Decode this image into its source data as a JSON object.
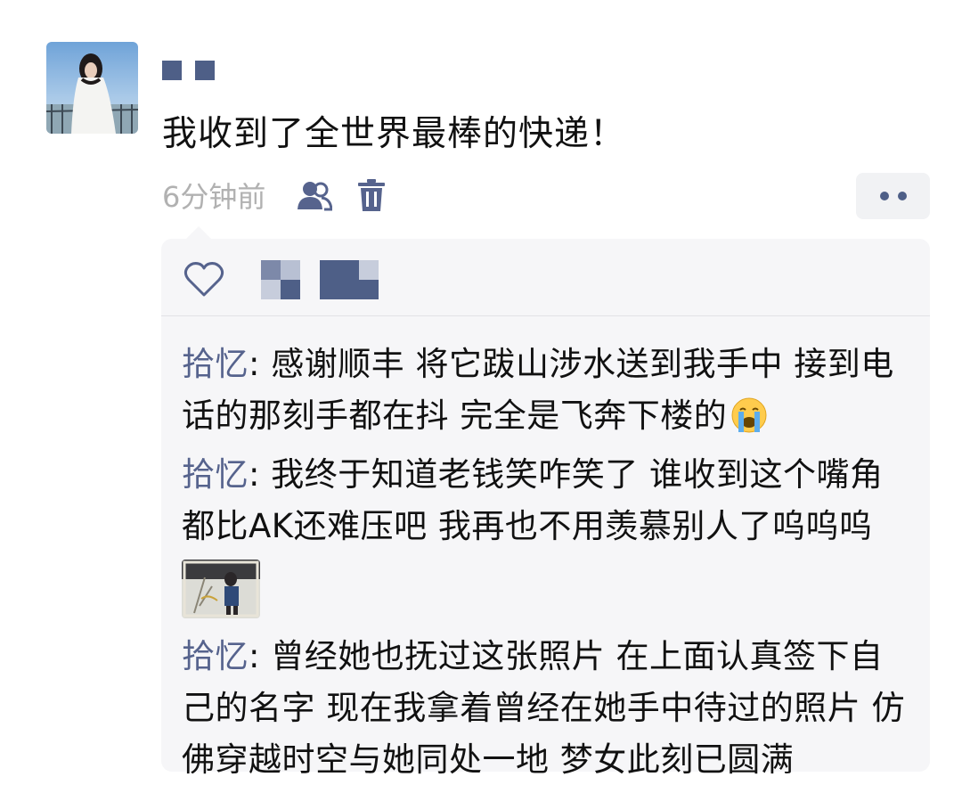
{
  "post": {
    "text": "我收到了全世界最棒的快递！",
    "timestamp": "6分钟前"
  },
  "icons": {
    "avatar": "user-avatar-photo",
    "visibility": "friends-icon",
    "delete": "trash-icon",
    "more": "more-dots-icon",
    "like": "heart-outline-icon",
    "emoji": "crying-face-emoji",
    "attachment": "photo-thumbnail"
  },
  "colors": {
    "accent": "#56638d",
    "muted": "#b1b1b1",
    "panel": "#f6f6f8"
  },
  "comments": [
    {
      "author": "拾忆",
      "separator": ": ",
      "text": "感谢顺丰 将它跋山涉水送到我手中 接到电话的那刻手都在抖 完全是飞奔下楼的",
      "emoji": "😭"
    },
    {
      "author": "拾忆",
      "separator": ": ",
      "text": "我终于知道老钱笑咋笑了 谁收到这个嘴角都比AK还难压吧 我再也不用羡慕别人了呜呜呜",
      "has_image": true
    },
    {
      "author": "拾忆",
      "separator": ": ",
      "text": "曾经她也抚过这张照片 在上面认真签下自己的名字 现在我拿着曾经在她手中待过的照片 仿佛穿越时空与她同处一地 梦女此刻已圆满"
    }
  ]
}
